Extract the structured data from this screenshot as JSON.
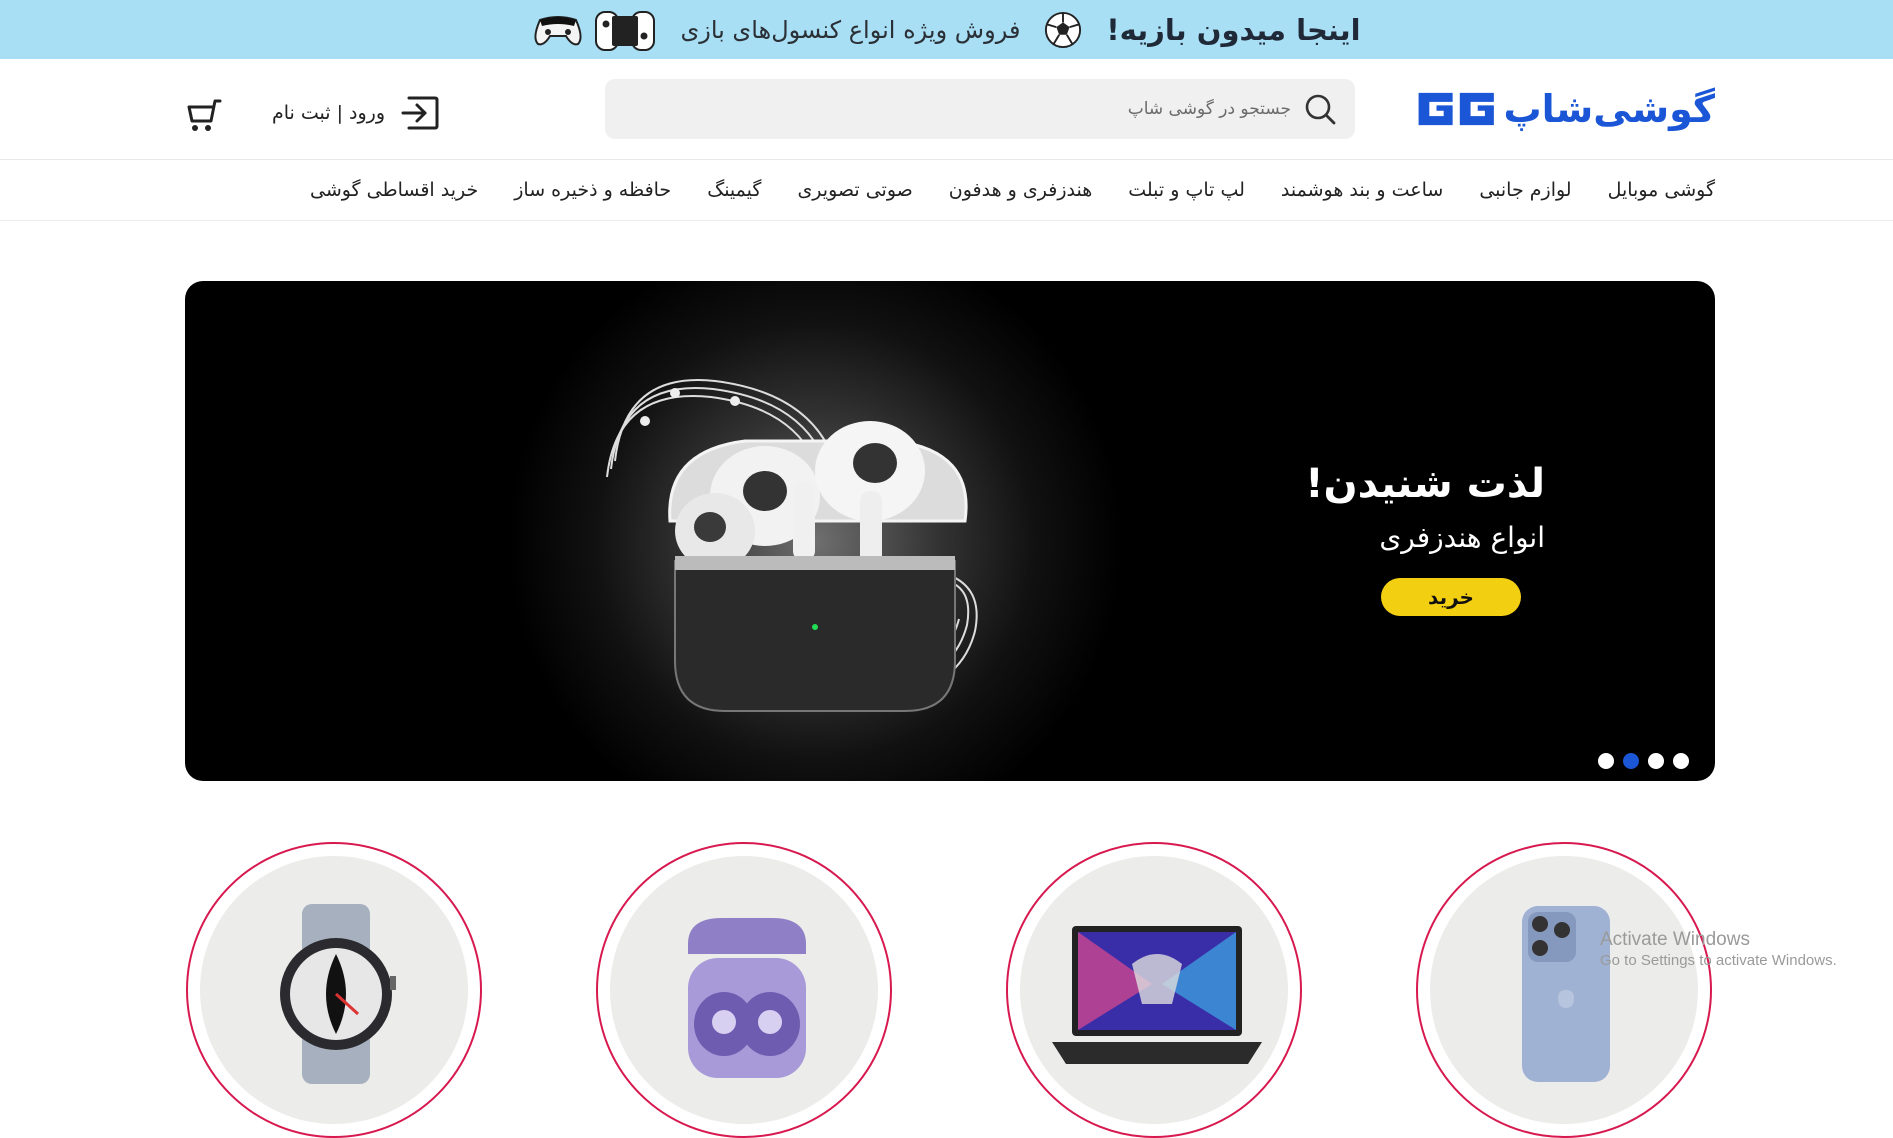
{
  "promo": {
    "title": "اینجا میدون بازیه!",
    "subtitle": "فروش ویژه انواع کنسول‌های بازی",
    "ball_icon": "soccer-ball-icon",
    "console_icons": [
      "gamepad-icon",
      "switch-controller-icon"
    ]
  },
  "header": {
    "logo_text": "گوشی‌شاپ",
    "logo_mark": "GG",
    "search_placeholder": "جستجو در گوشی شاپ",
    "login_label": "ورود | ثبت نام",
    "cart_icon": "cart-icon"
  },
  "nav": {
    "items": [
      "گوشی موبایل",
      "لوازم جانبی",
      "ساعت و بند هوشمند",
      "لپ تاپ و تبلت",
      "هندزفری و هدفون",
      "صوتی تصویری",
      "گیمینگ",
      "حافظه و ذخیره ساز",
      "خرید اقساطی گوشی"
    ]
  },
  "hero": {
    "title": "لذت شنیدن!",
    "subtitle": "انواع هندزفری",
    "button": "خرید",
    "slide_count": 4,
    "active_slide": 2
  },
  "categories": [
    {
      "name": "smartwatch",
      "icon": "smartwatch-icon"
    },
    {
      "name": "earbuds",
      "icon": "earbuds-icon"
    },
    {
      "name": "laptop",
      "icon": "laptop-icon"
    },
    {
      "name": "iphone",
      "icon": "smartphone-icon"
    }
  ],
  "watermark": {
    "title": "Activate Windows",
    "subtitle": "Go to Settings to activate Windows."
  },
  "colors": {
    "promo_bg": "#a8dff5",
    "brand": "#1a56d6",
    "accent_yellow": "#f3cf12",
    "circle_border": "#d7194f"
  }
}
